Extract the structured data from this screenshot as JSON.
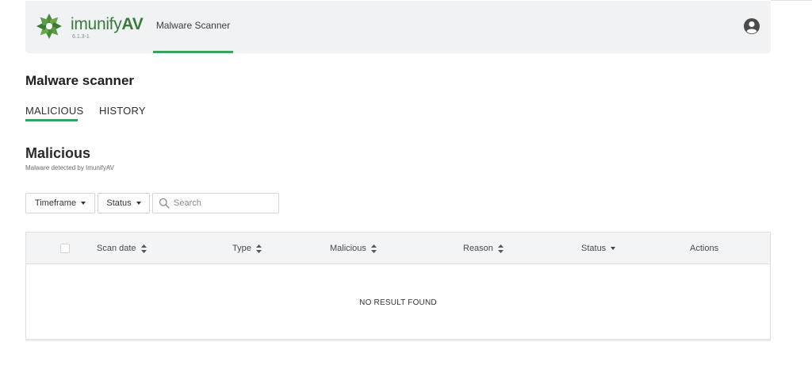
{
  "header": {
    "brand_prefix": "imunify",
    "brand_suffix": "AV",
    "version": "6.1.3-1",
    "nav_tab": "Malware Scanner",
    "logo_icon": "imunify-leaf-logo-icon",
    "avatar_icon": "user-avatar-icon",
    "accent_color": "#3aa25b"
  },
  "page": {
    "title": "Malware scanner",
    "tabs": [
      {
        "label": "MALICIOUS",
        "active": true
      },
      {
        "label": "HISTORY",
        "active": false
      }
    ]
  },
  "section": {
    "title": "Malicious",
    "subtitle": "Malware detected by ImunifyAV"
  },
  "filters": {
    "timeframe_label": "Timeframe",
    "status_label": "Status",
    "search_placeholder": "Search",
    "search_value": ""
  },
  "table": {
    "columns": [
      {
        "label": "Scan date",
        "sort": "both"
      },
      {
        "label": "Type",
        "sort": "both"
      },
      {
        "label": "Malicious",
        "sort": "both"
      },
      {
        "label": "Reason",
        "sort": "both"
      },
      {
        "label": "Status",
        "sort": "dropdown"
      },
      {
        "label": "Actions",
        "sort": "none"
      }
    ],
    "rows": [],
    "empty_message": "NO RESULT FOUND"
  }
}
